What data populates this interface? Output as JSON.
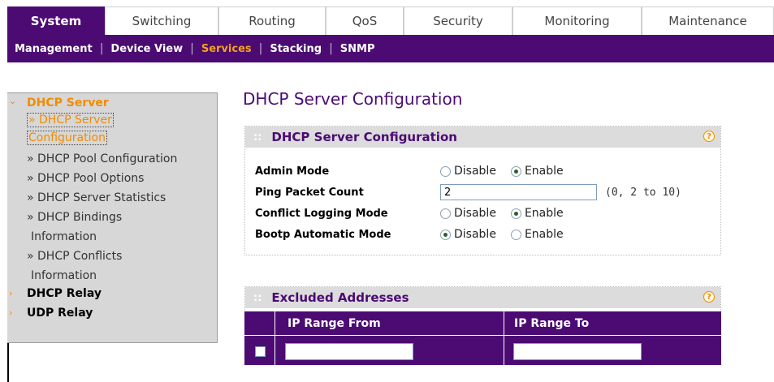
{
  "tabs": [
    {
      "label": "System",
      "active": true
    },
    {
      "label": "Switching",
      "active": false
    },
    {
      "label": "Routing",
      "active": false
    },
    {
      "label": "QoS",
      "active": false
    },
    {
      "label": "Security",
      "active": false
    },
    {
      "label": "Monitoring",
      "active": false
    },
    {
      "label": "Maintenance",
      "active": false
    }
  ],
  "subnav": [
    {
      "label": "Management",
      "active": false
    },
    {
      "label": "Device View",
      "active": false
    },
    {
      "label": "Services",
      "active": true
    },
    {
      "label": "Stacking",
      "active": false
    },
    {
      "label": "SNMP",
      "active": false
    }
  ],
  "sidebar": {
    "dhcp_server": "DHCP Server",
    "items": [
      "» DHCP Server",
      "Configuration",
      "» DHCP Pool Configuration",
      "» DHCP Pool Options",
      "» DHCP Server Statistics",
      "» DHCP Bindings",
      "Information",
      "» DHCP Conflicts",
      "Information"
    ],
    "dhcp_relay": "DHCP Relay",
    "udp_relay": "UDP Relay"
  },
  "page_title": "DHCP Server Configuration",
  "config_panel": {
    "title": "DHCP Server Configuration",
    "help": "?",
    "admin_mode": {
      "label": "Admin Mode",
      "opt1": "Disable",
      "opt2": "Enable",
      "selected": "Enable"
    },
    "ping_packet_count": {
      "label": "Ping Packet Count",
      "value": "2",
      "hint": "(0, 2 to 10)"
    },
    "conflict_logging": {
      "label": "Conflict Logging Mode",
      "opt1": "Disable",
      "opt2": "Enable",
      "selected": "Enable"
    },
    "bootp": {
      "label": "Bootp Automatic Mode",
      "opt1": "Disable",
      "opt2": "Enable",
      "selected": "Disable"
    }
  },
  "excluded_panel": {
    "title": "Excluded Addresses",
    "help": "?",
    "columns": [
      "IP Range From",
      "IP Range To"
    ]
  },
  "colors": {
    "brand": "#4b0b73",
    "accent": "#f08c00"
  }
}
